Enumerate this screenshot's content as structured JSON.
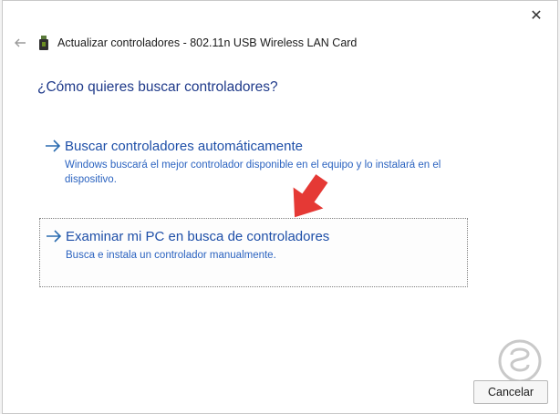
{
  "window": {
    "title": "Actualizar controladores - 802.11n USB Wireless LAN Card",
    "close_icon": "✕"
  },
  "question": "¿Cómo quieres buscar controladores?",
  "options": [
    {
      "title": "Buscar controladores automáticamente",
      "description": "Windows buscará el mejor controlador disponible en el equipo y lo instalará en el dispositivo."
    },
    {
      "title": "Examinar mi PC en busca de controladores",
      "description": "Busca e instala un controlador manualmente."
    }
  ],
  "buttons": {
    "cancel": "Cancelar"
  },
  "colors": {
    "link": "#1e4fa8",
    "arrow_overlay": "#e53935"
  }
}
